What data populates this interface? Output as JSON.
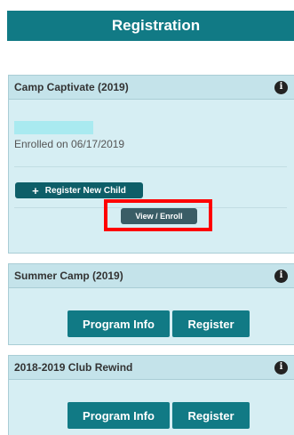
{
  "header": {
    "title": "Registration"
  },
  "cards": [
    {
      "title": "Camp Captivate (2019)",
      "info_icon": "info-icon",
      "enrolled_text": "Enrolled on 06/17/2019",
      "register_child_label": "Register New Child",
      "view_enroll_label": "View / Enroll"
    },
    {
      "title": "Summer Camp (2019)",
      "info_icon": "info-icon",
      "program_info_label": "Program Info",
      "register_label": "Register"
    },
    {
      "title": "2018-2019 Club Rewind",
      "info_icon": "info-icon",
      "program_info_label": "Program Info",
      "register_label": "Register"
    }
  ],
  "colors": {
    "header_bg": "#117a85",
    "card_bg": "#d6eef3",
    "button_teal": "#117a85",
    "button_dark": "#0e5e68",
    "highlight": "#ff0000"
  }
}
